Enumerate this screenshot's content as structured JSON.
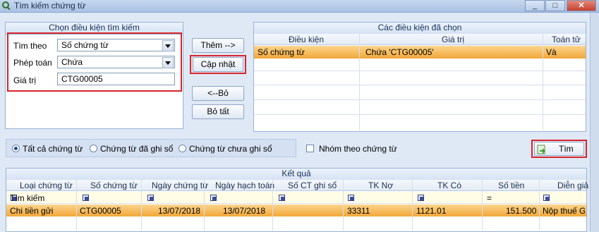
{
  "window": {
    "title": "Tìm kiếm chứng từ",
    "close_glyph": "✕",
    "min_glyph": "_",
    "max_glyph": "□"
  },
  "criteria": {
    "header": "Chọn điều kiện tìm kiếm",
    "find_by_label": "Tìm theo",
    "find_by_value": "Số chứng từ",
    "operator_label": "Phép toán",
    "operator_value": "Chứa",
    "value_label": "Giá trị",
    "value_value": "CTG00005"
  },
  "buttons": {
    "add": "Thêm -->",
    "update": "Cập nhật",
    "remove": "<--Bỏ",
    "remove_all": "Bỏ tất",
    "search": "Tìm"
  },
  "selected": {
    "header": "Các điều kiện đã chọn",
    "columns": [
      "Điều kiện",
      "Giá trị",
      "Toán tử"
    ],
    "rows": [
      {
        "condition": "Số chứng từ",
        "value": "Chứa 'CTG00005'",
        "operator": "Và"
      }
    ]
  },
  "filters": {
    "all": "Tất cả chứng từ",
    "posted": "Chứng từ đã ghi sổ",
    "unposted": "Chứng từ chưa ghi sổ",
    "selected": "all",
    "group_label": "Nhóm theo chứng từ"
  },
  "results": {
    "header": "Kết quả",
    "columns": [
      "Loại chứng từ",
      "Số chứng từ",
      "Ngày chứng từ",
      "Ngày hạch toán",
      "Số CT ghi sổ",
      "TK Nợ",
      "TK Có",
      "Số tiền",
      "Diễn giả"
    ],
    "filter_row_label": "Tìm kiếm",
    "filter_eq": "=",
    "rows": [
      {
        "type": "Chi tiền gửi",
        "number": "CTG00005",
        "doc_date": "13/07/2018",
        "post_date": "13/07/2018",
        "ledger_no": "",
        "debit": "33311",
        "credit": "1121.01",
        "amount": "151.500",
        "desc": "Nộp thuế GT"
      }
    ]
  },
  "colors": {
    "accent": "#f6b640",
    "highlight": "#d9242b",
    "panel_border": "#98b3d9"
  }
}
